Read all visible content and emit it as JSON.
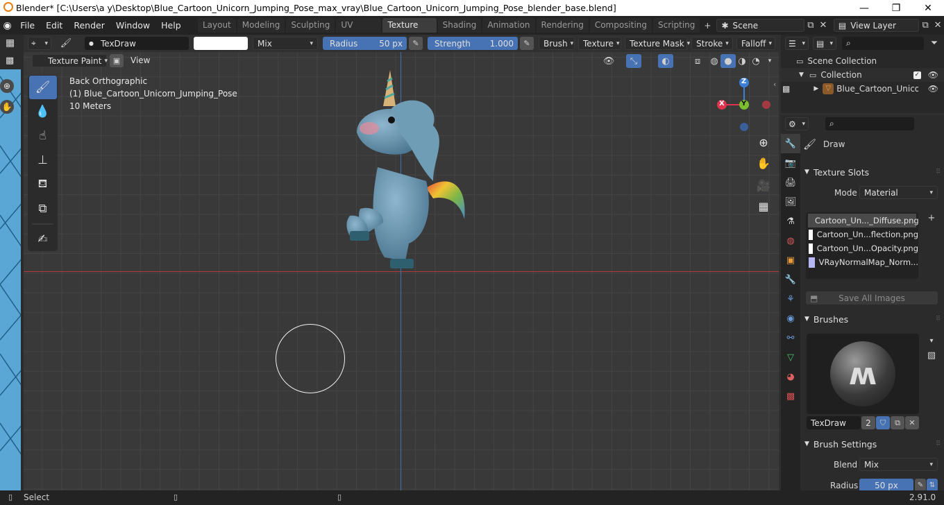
{
  "window": {
    "title": "Blender* [C:\\Users\\a y\\Desktop\\Blue_Cartoon_Unicorn_Jumping_Pose_max_vray\\Blue_Cartoon_Unicorn_Jumping_Pose_blender_base.blend]",
    "minimize": "—",
    "maximize": "❐",
    "close": "✕"
  },
  "menu": {
    "items": [
      "File",
      "Edit",
      "Render",
      "Window",
      "Help"
    ]
  },
  "workspaces": {
    "tabs": [
      "Layout",
      "Modeling",
      "Sculpting",
      "UV Editing",
      "Texture Paint",
      "Shading",
      "Animation",
      "Rendering",
      "Compositing",
      "Scripting"
    ],
    "active": "Texture Paint",
    "add": "+"
  },
  "scene": {
    "name": "Scene",
    "view_layer": "View Layer"
  },
  "toolsettings": {
    "brush_name": "TexDraw",
    "blend": "Mix",
    "radius_label": "Radius",
    "radius_value": "50 px",
    "strength_label": "Strength",
    "strength_value": "1.000",
    "menus": [
      "Brush",
      "Texture",
      "Texture Mask",
      "Stroke",
      "Falloff"
    ]
  },
  "header": {
    "mode": "Texture Paint",
    "view": "View"
  },
  "viewport": {
    "view_name": "Back Orthographic",
    "object_label": "(1) Blue_Cartoon_Unicorn_Jumping_Pose",
    "scale": "10 Meters",
    "axes": {
      "x": "X",
      "y": "Y",
      "z": "Z"
    }
  },
  "outliner": {
    "scene_collection": "Scene Collection",
    "collection": "Collection",
    "object": "Blue_Cartoon_Unicorn"
  },
  "properties": {
    "active_tool": "Draw",
    "texture_slots": {
      "title": "Texture Slots",
      "mode_label": "Mode",
      "mode_value": "Material",
      "slots": [
        "Cartoon_Un..._Diffuse.png",
        "Cartoon_Un...flection.png",
        "Cartoon_Un...Opacity.png",
        "VRayNormalMap_Norm..."
      ],
      "save_all": "Save All Images"
    },
    "brushes": {
      "title": "Brushes",
      "brush_name": "TexDraw",
      "users": "2"
    },
    "brush_settings": {
      "title": "Brush Settings",
      "blend_label": "Blend",
      "blend_value": "Mix",
      "radius_label": "Radius",
      "radius_value": "50 px"
    }
  },
  "status": {
    "left": "Select",
    "version": "2.91.0"
  }
}
